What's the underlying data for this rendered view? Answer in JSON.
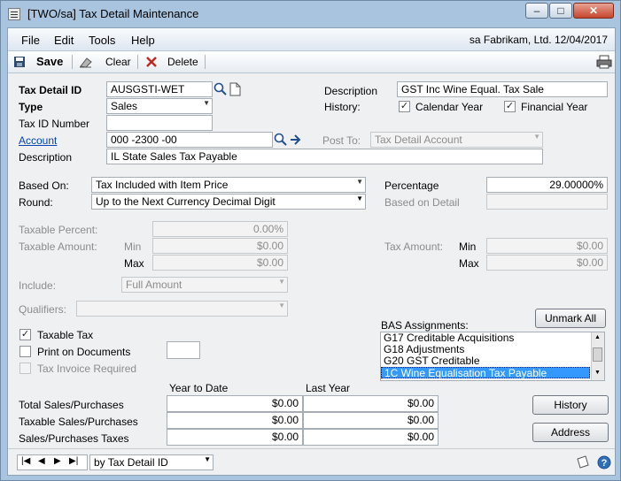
{
  "window": {
    "title": "[TWO/sa] Tax Detail Maintenance"
  },
  "menu": {
    "items": [
      "File",
      "Edit",
      "Tools",
      "Help"
    ],
    "user_info": "sa  Fabrikam, Ltd.  12/04/2017"
  },
  "toolbar": {
    "save": "Save",
    "clear": "Clear",
    "delete": "Delete"
  },
  "form": {
    "tax_detail_id_label": "Tax Detail ID",
    "tax_detail_id": "AUSGSTI-WET",
    "description_label": "Description",
    "description": "GST Inc Wine Equal. Tax Sale",
    "type_label": "Type",
    "type": "Sales",
    "history_label": "History:",
    "calendar_year": "Calendar Year",
    "financial_year": "Financial Year",
    "tax_id_number_label": "Tax ID Number",
    "account_label": "Account",
    "account": "000 -2300 -00",
    "post_to_label": "Post To:",
    "post_to": "Tax Detail Account",
    "account_description_label": "Description",
    "account_description": "IL State Sales Tax Payable",
    "based_on_label": "Based On:",
    "based_on": "Tax Included with Item Price",
    "percentage_label": "Percentage",
    "percentage": "29.00000%",
    "round_label": "Round:",
    "round": "Up to the Next Currency Decimal Digit",
    "based_on_detail_label": "Based on Detail",
    "taxable_percent_label": "Taxable Percent:",
    "taxable_percent": "0.00%",
    "taxable_amount_label": "Taxable Amount:",
    "min_label": "Min",
    "max_label": "Max",
    "taxable_min": "$0.00",
    "taxable_max": "$0.00",
    "tax_amount_label": "Tax Amount:",
    "tax_min": "$0.00",
    "tax_max": "$0.00",
    "include_label": "Include:",
    "include": "Full Amount",
    "qualifiers_label": "Qualifiers:",
    "bas_label": "BAS Assignments:",
    "unmark_all": "Unmark All",
    "bas_items": [
      "G17 Creditable Acquisitions",
      "G18 Adjustments",
      "G20 GST Creditable",
      "1C Wine Equalisation Tax Payable"
    ],
    "taxable_tax": "Taxable Tax",
    "print_on_documents": "Print on Documents",
    "tax_invoice_required": "Tax Invoice Required",
    "year_to_date": "Year to Date",
    "last_year": "Last Year",
    "rows": [
      {
        "label": "Total Sales/Purchases",
        "ytd": "$0.00",
        "ly": "$0.00"
      },
      {
        "label": "Taxable Sales/Purchases",
        "ytd": "$0.00",
        "ly": "$0.00"
      },
      {
        "label": "Sales/Purchases Taxes",
        "ytd": "$0.00",
        "ly": "$0.00"
      }
    ],
    "history_button": "History",
    "address_button": "Address"
  },
  "bottom": {
    "sort_by": "by Tax Detail ID"
  },
  "colors": {
    "accent": "#3399ff",
    "link": "#0645ad",
    "frame": "#a9c4de"
  }
}
